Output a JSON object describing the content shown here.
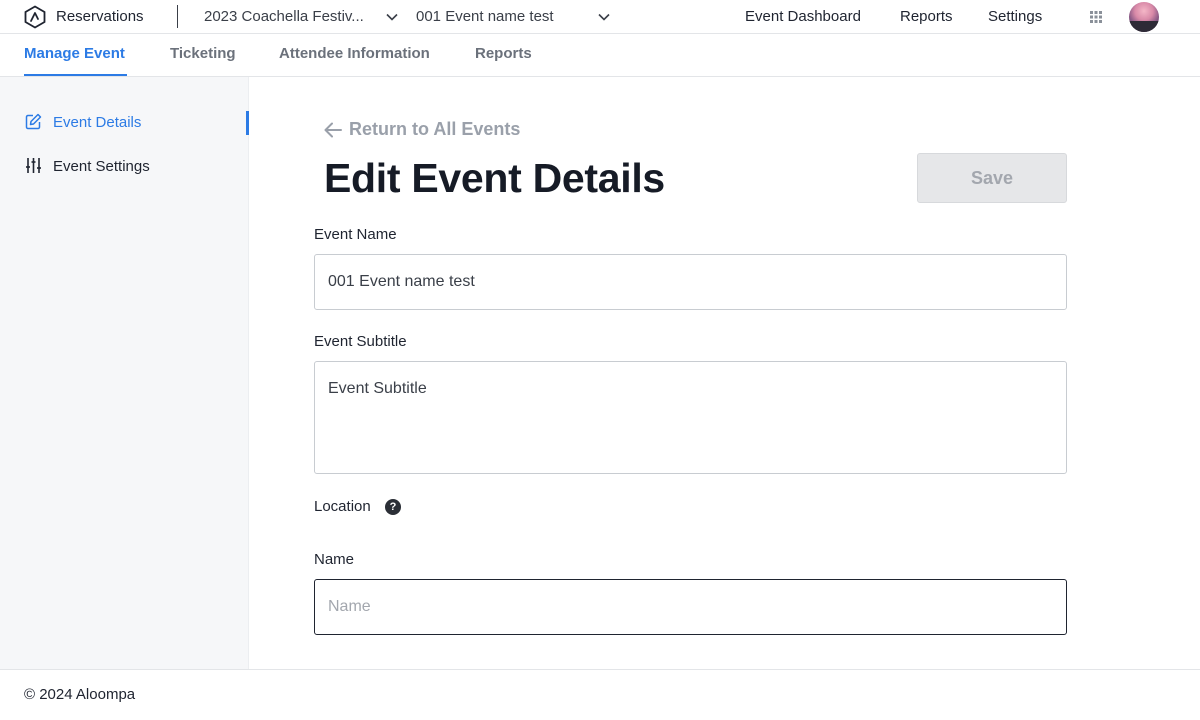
{
  "topbar": {
    "app_name": "Reservations",
    "festival_selector": "2023 Coachella Festiv...",
    "event_selector": "001 Event name test",
    "nav": [
      "Event Dashboard",
      "Reports",
      "Settings"
    ]
  },
  "subnav": {
    "tabs": [
      "Manage Event",
      "Ticketing",
      "Attendee Information",
      "Reports"
    ],
    "active_tab": "Manage Event"
  },
  "sidebar": {
    "items": [
      {
        "label": "Event Details",
        "icon": "edit-icon"
      },
      {
        "label": "Event Settings",
        "icon": "sliders-icon"
      }
    ],
    "active_item": "Event Details"
  },
  "main": {
    "return_link": "Return to All Events",
    "title": "Edit Event Details",
    "save_label": "Save",
    "event_name_label": "Event Name",
    "event_name_value": "001 Event name test",
    "event_subtitle_label": "Event Subtitle",
    "event_subtitle_placeholder": "Event Subtitle",
    "location_label": "Location",
    "location_help": "?",
    "name_label": "Name",
    "name_placeholder": "Name"
  },
  "footer": {
    "copyright": "© 2024 Aloompa"
  },
  "colors": {
    "accent": "#2c7be5",
    "title": "#161b26",
    "muted": "#9aa0aa",
    "sidebar_bg": "#f6f7f9",
    "save_disabled_bg": "#e6e7e9"
  }
}
